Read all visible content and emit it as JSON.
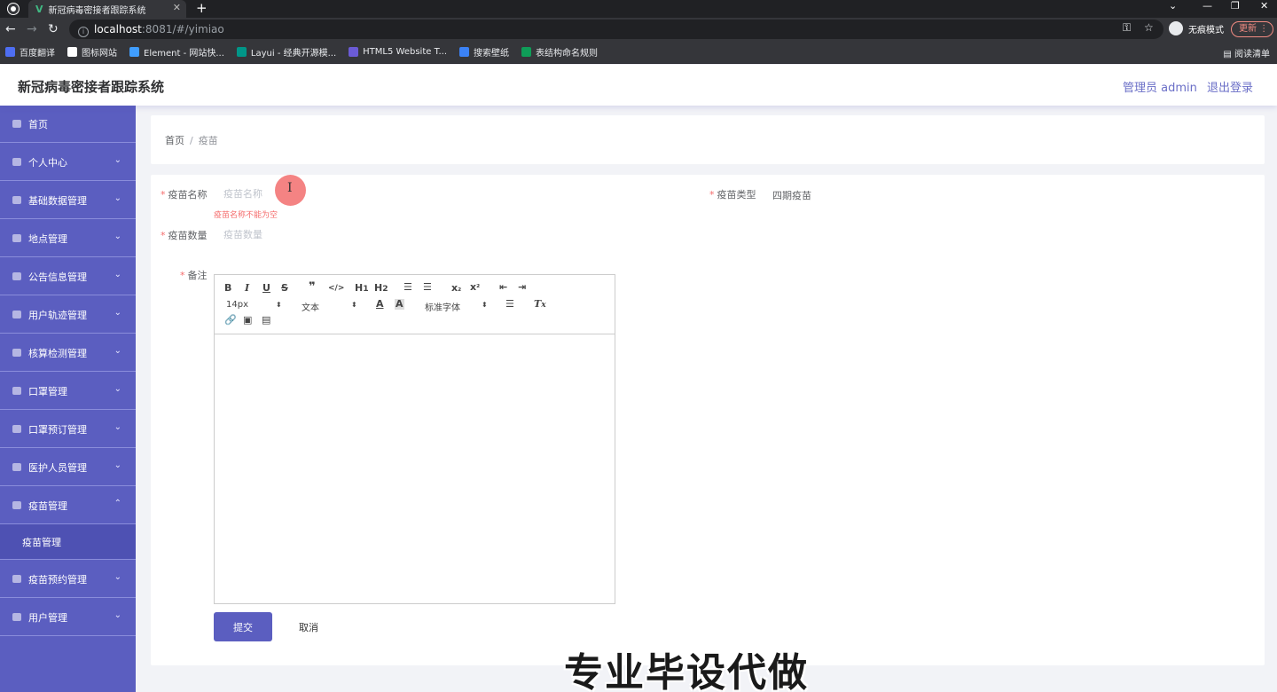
{
  "browser": {
    "tab_title": "新冠病毒密接者跟踪系统",
    "url_host": "localhost",
    "url_path": ":8081/#/yimiao",
    "incognito_label": "无痕模式",
    "update_label": "更新",
    "reading_list": "阅读清单",
    "bookmarks": [
      {
        "label": "百度翻译",
        "color": "#4e6ef2"
      },
      {
        "label": "图标网站",
        "color": "#ffffff"
      },
      {
        "label": "Element - 网站快...",
        "color": "#409eff"
      },
      {
        "label": "Layui - 经典开源模...",
        "color": "#009688"
      },
      {
        "label": "HTML5 Website T...",
        "color": "#6b5bd6"
      },
      {
        "label": "搜索壁纸",
        "color": "#3b82f6"
      },
      {
        "label": "表结构命名规则",
        "color": "#0f9d58"
      }
    ]
  },
  "header": {
    "title": "新冠病毒密接者跟踪系统",
    "user": "管理员 admin",
    "logout": "退出登录"
  },
  "sidebar": {
    "items": [
      {
        "label": "首页",
        "chevron": ""
      },
      {
        "label": "个人中心",
        "chevron": "⌄"
      },
      {
        "label": "基础数据管理",
        "chevron": "⌄"
      },
      {
        "label": "地点管理",
        "chevron": "⌄"
      },
      {
        "label": "公告信息管理",
        "chevron": "⌄"
      },
      {
        "label": "用户轨迹管理",
        "chevron": "⌄"
      },
      {
        "label": "核算检测管理",
        "chevron": "⌄"
      },
      {
        "label": "口罩管理",
        "chevron": "⌄"
      },
      {
        "label": "口罩预订管理",
        "chevron": "⌄"
      },
      {
        "label": "医护人员管理",
        "chevron": "⌄"
      },
      {
        "label": "疫苗管理",
        "chevron": "⌃"
      },
      {
        "label": "疫苗预约管理",
        "chevron": "⌄"
      },
      {
        "label": "用户管理",
        "chevron": "⌄"
      }
    ],
    "sub_item": "疫苗管理"
  },
  "breadcrumb": {
    "home": "首页",
    "sep": "/",
    "current": "疫苗"
  },
  "form": {
    "name_label": "疫苗名称",
    "name_placeholder": "疫苗名称",
    "name_error": "疫苗名称不能为空",
    "type_label": "疫苗类型",
    "type_value": "四期疫苗",
    "qty_label": "疫苗数量",
    "qty_placeholder": "疫苗数量",
    "remark_label": "备注",
    "required_mark": "*",
    "submit": "提交",
    "cancel": "取消"
  },
  "editor": {
    "font_size": "14px",
    "header_select": "文本",
    "font_family": "标准字体"
  },
  "watermark": "专业毕设代做"
}
